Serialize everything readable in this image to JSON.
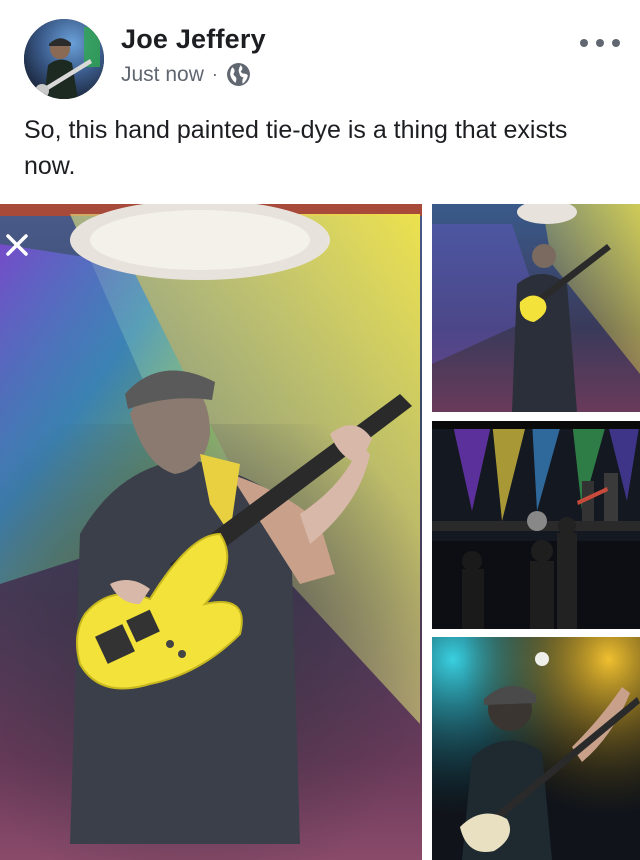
{
  "post": {
    "author": "Joe Jeffery",
    "timestamp": "Just now",
    "separator": "·",
    "privacy_icon": "globe-icon",
    "more_icon": "more-options-icon",
    "text": "So, this hand painted tie-dye is a thing that exists now."
  },
  "photos": {
    "count": 4,
    "close_icon": "close-icon"
  }
}
